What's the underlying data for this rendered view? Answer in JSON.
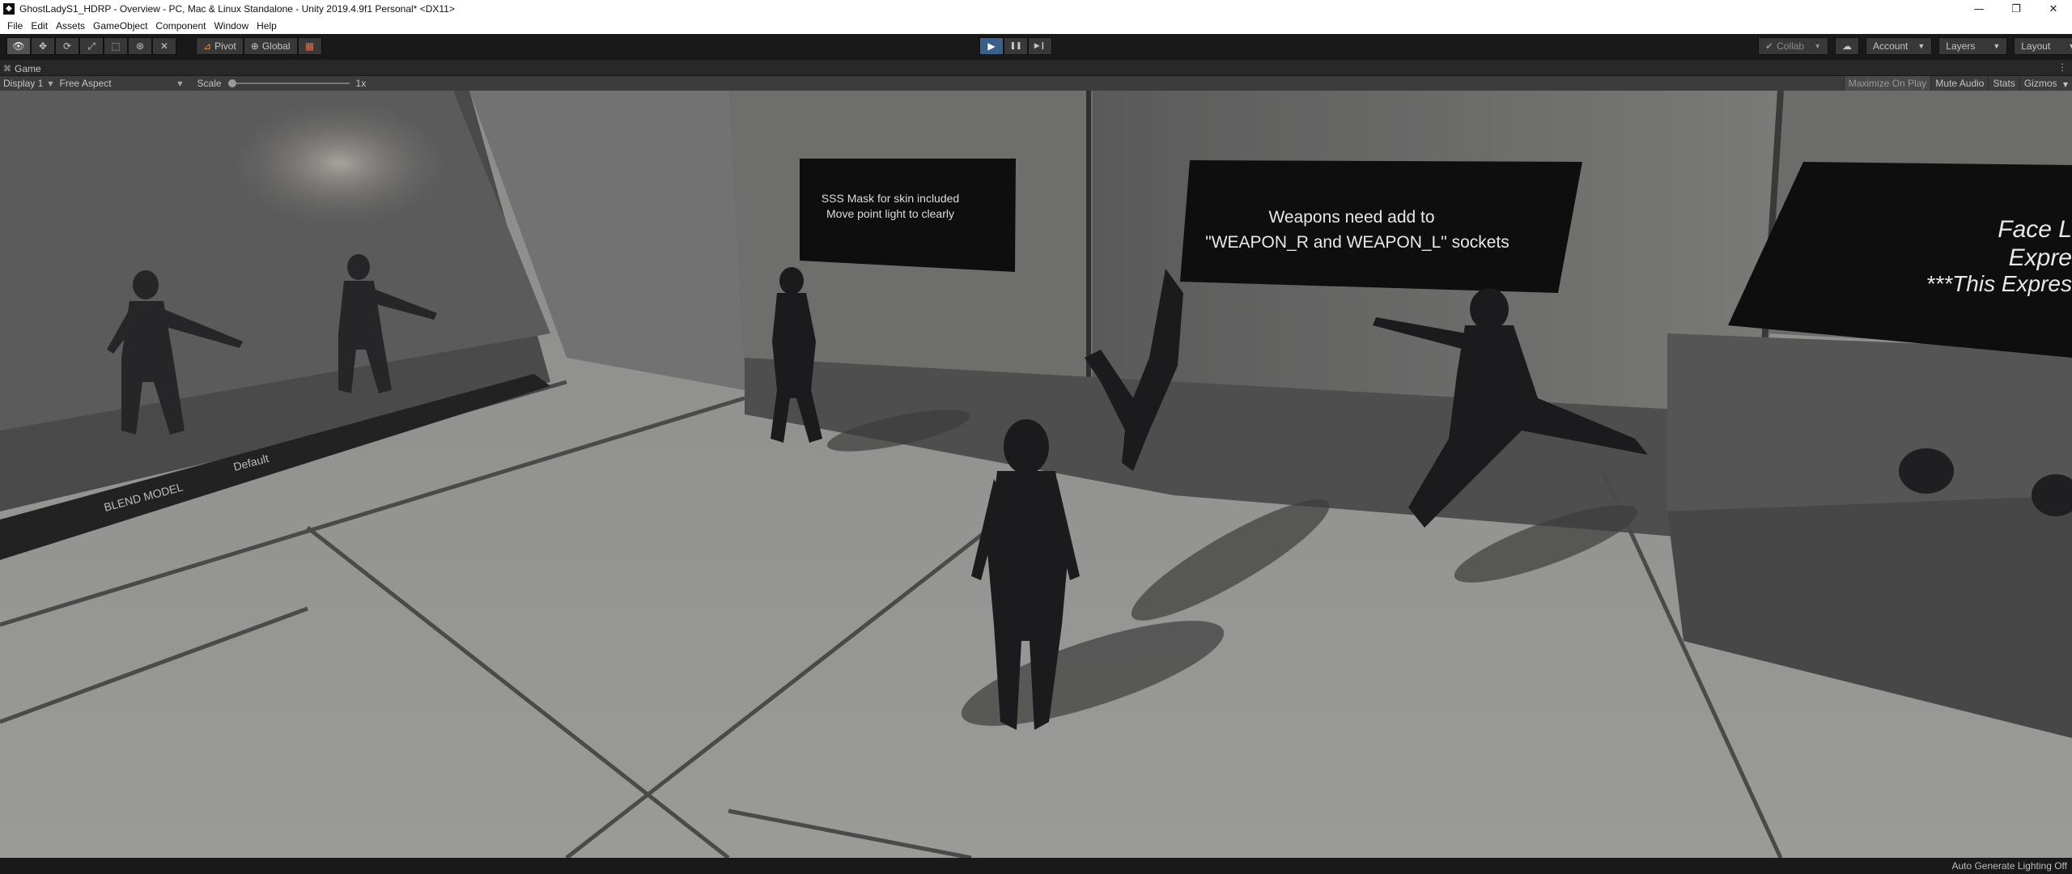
{
  "window": {
    "title": "GhostLadyS1_HDRP - Overview - PC, Mac & Linux Standalone - Unity 2019.4.9f1 Personal* <DX11>",
    "app_icon": "unity-logo-icon",
    "minimize": "—",
    "maximize": "❐",
    "close": "✕"
  },
  "menu": {
    "items": [
      "File",
      "Edit",
      "Assets",
      "GameObject",
      "Component",
      "Window",
      "Help"
    ]
  },
  "toolbar": {
    "tools": [
      {
        "icon": "hand-tool-icon",
        "glyph": "👁",
        "active": true
      },
      {
        "icon": "move-tool-icon",
        "glyph": "✥",
        "active": false
      },
      {
        "icon": "rotate-tool-icon",
        "glyph": "⟳",
        "active": false
      },
      {
        "icon": "scale-tool-icon",
        "glyph": "⤢",
        "active": false
      },
      {
        "icon": "rect-tool-icon",
        "glyph": "⬚",
        "active": false
      },
      {
        "icon": "transform-tool-icon",
        "glyph": "⊛",
        "active": false
      },
      {
        "icon": "custom-tool-icon",
        "glyph": "✕",
        "active": false
      }
    ],
    "pivot_label": "Pivot",
    "global_label": "Global",
    "grid_snap_icon": "grid-snap-icon",
    "play_icon": "▶",
    "pause_icon": "❚❚",
    "step_icon": "▶❙",
    "collab_label": "Collab",
    "account_label": "Account",
    "layers_label": "Layers",
    "layout_label": "Layout"
  },
  "game_tab": {
    "label": "Game",
    "icon": "game-controller-icon"
  },
  "game_bar": {
    "display": "Display 1",
    "aspect": "Free Aspect",
    "scale_label": "Scale",
    "scale_value": "1x",
    "scale_level": 0,
    "maximize_on_play": "Maximize On Play",
    "mute_audio": "Mute Audio",
    "stats": "Stats",
    "gizmos": "Gizmos"
  },
  "scene": {
    "sign_sss_line1": "SSS Mask for skin included",
    "sign_sss_line2": "Move point light to clearly",
    "sign_weapons_line1": "Weapons need add to",
    "sign_weapons_line2": "\"WEAPON_R and WEAPON_L\" sockets",
    "sign_face_line1": "Face L",
    "sign_face_line2": "Expre",
    "sign_face_line3": "***This Expres",
    "floor_label1": "BLEND MODEL",
    "floor_label2": "Default"
  },
  "status": {
    "text": "Auto Generate Lighting Off"
  }
}
